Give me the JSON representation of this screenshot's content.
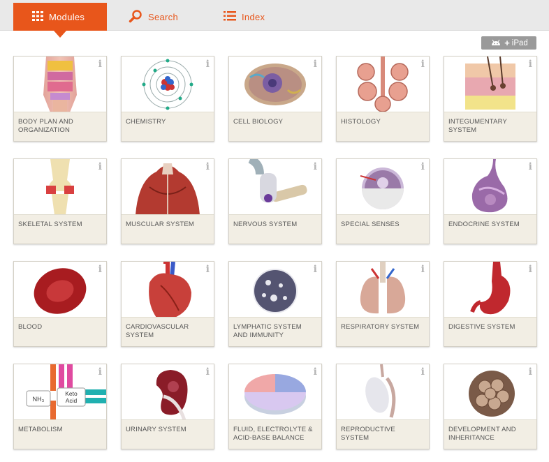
{
  "nav": {
    "tabs": [
      {
        "label": "Modules",
        "icon": "grid-icon",
        "active": true
      },
      {
        "label": "Search",
        "icon": "search-icon",
        "active": false
      },
      {
        "label": "Index",
        "icon": "list-icon",
        "active": false
      }
    ],
    "accent_color": "#e8561b"
  },
  "platform_badge": {
    "text": "iPad",
    "icons": [
      "android-icon",
      "plus-icon"
    ]
  },
  "info_glyph": "i",
  "modules": [
    {
      "label": "BODY PLAN AND ORGANIZATION",
      "thumb": "torso"
    },
    {
      "label": "CHEMISTRY",
      "thumb": "atom"
    },
    {
      "label": "CELL BIOLOGY",
      "thumb": "cell"
    },
    {
      "label": "HISTOLOGY",
      "thumb": "gland"
    },
    {
      "label": "INTEGUMENTARY SYSTEM",
      "thumb": "skin"
    },
    {
      "label": "SKELETAL SYSTEM",
      "thumb": "knee"
    },
    {
      "label": "MUSCULAR SYSTEM",
      "thumb": "back-muscles"
    },
    {
      "label": "NERVOUS SYSTEM",
      "thumb": "neuron"
    },
    {
      "label": "SPECIAL SENSES",
      "thumb": "eye"
    },
    {
      "label": "ENDOCRINE SYSTEM",
      "thumb": "thyroid"
    },
    {
      "label": "BLOOD",
      "thumb": "red-blood-cell"
    },
    {
      "label": "CARDIOVASCULAR SYSTEM",
      "thumb": "heart"
    },
    {
      "label": "LYMPHATIC SYSTEM AND IMMUNITY",
      "thumb": "lymphocyte"
    },
    {
      "label": "RESPIRATORY SYSTEM",
      "thumb": "lungs"
    },
    {
      "label": "DIGESTIVE SYSTEM",
      "thumb": "stomach"
    },
    {
      "label": "METABOLISM",
      "thumb": "metabolism",
      "thumb_text": [
        "NH₃",
        "Keto",
        "Acid"
      ]
    },
    {
      "label": "URINARY SYSTEM",
      "thumb": "kidney"
    },
    {
      "label": "FLUID, ELECTROLYTE & ACID-BASE BALANCE",
      "thumb": "pie"
    },
    {
      "label": "REPRODUCTIVE SYSTEM",
      "thumb": "testis"
    },
    {
      "label": "DEVELOPMENT AND INHERITANCE",
      "thumb": "embryo"
    }
  ]
}
